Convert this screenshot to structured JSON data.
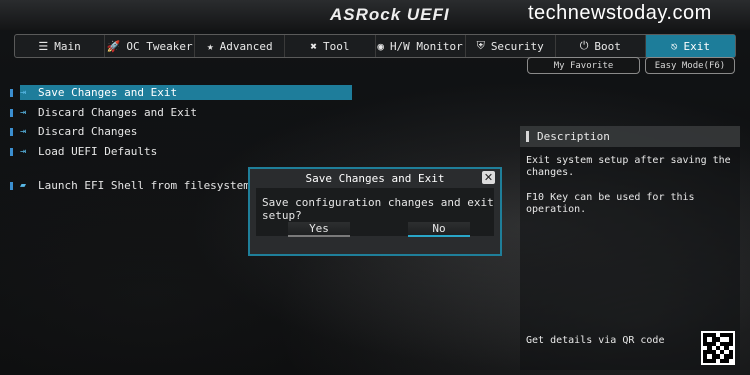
{
  "header": {
    "brand": "ASRock UEFI",
    "watermark": "technewstoday.com"
  },
  "tabs": [
    {
      "label": "Main",
      "icon": "list-icon"
    },
    {
      "label": "OC Tweaker",
      "icon": "rocket-icon"
    },
    {
      "label": "Advanced",
      "icon": "star-icon"
    },
    {
      "label": "Tool",
      "icon": "tools-icon"
    },
    {
      "label": "H/W Monitor",
      "icon": "gauge-icon"
    },
    {
      "label": "Security",
      "icon": "shield-icon"
    },
    {
      "label": "Boot",
      "icon": "power-icon"
    },
    {
      "label": "Exit",
      "icon": "exit-icon"
    }
  ],
  "active_tab": "Exit",
  "modes": {
    "favorite": "My Favorite",
    "easy": "Easy Mode(F6)"
  },
  "menu": [
    {
      "label": "Save Changes and Exit",
      "selected": true
    },
    {
      "label": "Discard Changes and Exit",
      "selected": false
    },
    {
      "label": "Discard Changes",
      "selected": false
    },
    {
      "label": "Load UEFI Defaults",
      "selected": false
    },
    {
      "label": "Launch EFI Shell from filesystem device",
      "selected": false
    }
  ],
  "description": {
    "title": "Description",
    "line1": "Exit system setup after saving the",
    "line2": "changes.",
    "line3": "F10 Key can be used for this operation.",
    "qr_text": "Get details via QR code"
  },
  "dialog": {
    "title": "Save Changes and Exit",
    "message": "Save configuration changes and exit setup?",
    "yes": "Yes",
    "no": "No",
    "focused": "No"
  },
  "colors": {
    "accent": "#1e7d9b",
    "icon_blue": "#59b8e6",
    "background": "#0b0d0f"
  }
}
